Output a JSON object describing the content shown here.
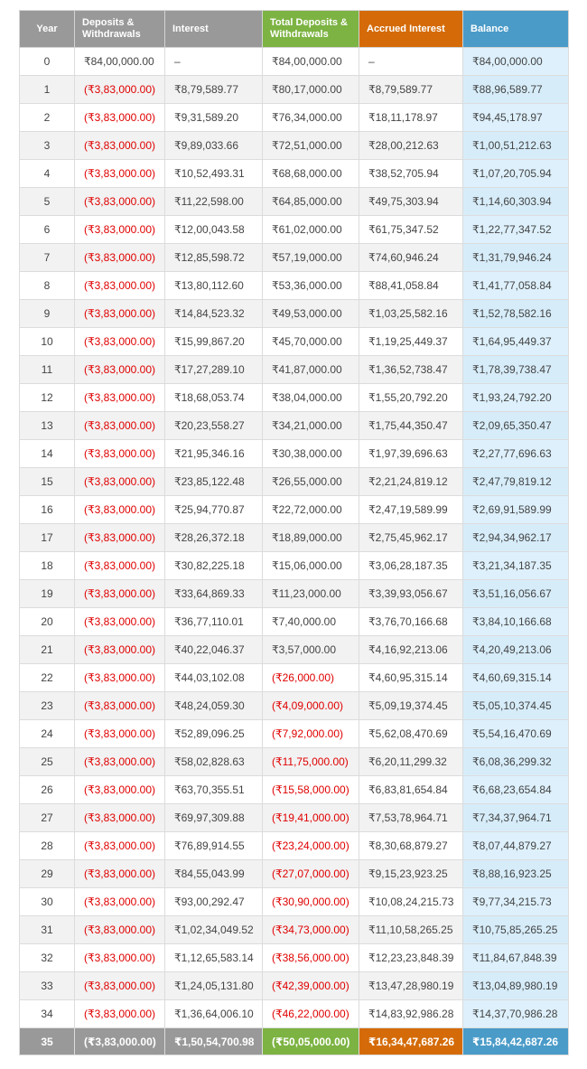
{
  "colors": {
    "header_gray": "#999999",
    "header_green": "#7cb342",
    "header_orange": "#d46b08",
    "header_blue": "#4a9bc8",
    "negative_text": "#e00000",
    "balance_cell_bg": "#ddf0fc"
  },
  "headers": [
    {
      "label": "Year",
      "color": "#999999"
    },
    {
      "label": "Deposits & Withdrawals",
      "color": "#999999"
    },
    {
      "label": "Interest",
      "color": "#999999"
    },
    {
      "label": "Total Deposits & Withdrawals",
      "color": "#7cb342"
    },
    {
      "label": "Accrued Interest",
      "color": "#d46b08"
    },
    {
      "label": "Balance",
      "color": "#4a9bc8"
    }
  ],
  "rows": [
    [
      "0",
      "₹84,00,000.00",
      "–",
      "₹84,00,000.00",
      "–",
      "₹84,00,000.00"
    ],
    [
      "1",
      "(₹3,83,000.00)",
      "₹8,79,589.77",
      "₹80,17,000.00",
      "₹8,79,589.77",
      "₹88,96,589.77"
    ],
    [
      "2",
      "(₹3,83,000.00)",
      "₹9,31,589.20",
      "₹76,34,000.00",
      "₹18,11,178.97",
      "₹94,45,178.97"
    ],
    [
      "3",
      "(₹3,83,000.00)",
      "₹9,89,033.66",
      "₹72,51,000.00",
      "₹28,00,212.63",
      "₹1,00,51,212.63"
    ],
    [
      "4",
      "(₹3,83,000.00)",
      "₹10,52,493.31",
      "₹68,68,000.00",
      "₹38,52,705.94",
      "₹1,07,20,705.94"
    ],
    [
      "5",
      "(₹3,83,000.00)",
      "₹11,22,598.00",
      "₹64,85,000.00",
      "₹49,75,303.94",
      "₹1,14,60,303.94"
    ],
    [
      "6",
      "(₹3,83,000.00)",
      "₹12,00,043.58",
      "₹61,02,000.00",
      "₹61,75,347.52",
      "₹1,22,77,347.52"
    ],
    [
      "7",
      "(₹3,83,000.00)",
      "₹12,85,598.72",
      "₹57,19,000.00",
      "₹74,60,946.24",
      "₹1,31,79,946.24"
    ],
    [
      "8",
      "(₹3,83,000.00)",
      "₹13,80,112.60",
      "₹53,36,000.00",
      "₹88,41,058.84",
      "₹1,41,77,058.84"
    ],
    [
      "9",
      "(₹3,83,000.00)",
      "₹14,84,523.32",
      "₹49,53,000.00",
      "₹1,03,25,582.16",
      "₹1,52,78,582.16"
    ],
    [
      "10",
      "(₹3,83,000.00)",
      "₹15,99,867.20",
      "₹45,70,000.00",
      "₹1,19,25,449.37",
      "₹1,64,95,449.37"
    ],
    [
      "11",
      "(₹3,83,000.00)",
      "₹17,27,289.10",
      "₹41,87,000.00",
      "₹1,36,52,738.47",
      "₹1,78,39,738.47"
    ],
    [
      "12",
      "(₹3,83,000.00)",
      "₹18,68,053.74",
      "₹38,04,000.00",
      "₹1,55,20,792.20",
      "₹1,93,24,792.20"
    ],
    [
      "13",
      "(₹3,83,000.00)",
      "₹20,23,558.27",
      "₹34,21,000.00",
      "₹1,75,44,350.47",
      "₹2,09,65,350.47"
    ],
    [
      "14",
      "(₹3,83,000.00)",
      "₹21,95,346.16",
      "₹30,38,000.00",
      "₹1,97,39,696.63",
      "₹2,27,77,696.63"
    ],
    [
      "15",
      "(₹3,83,000.00)",
      "₹23,85,122.48",
      "₹26,55,000.00",
      "₹2,21,24,819.12",
      "₹2,47,79,819.12"
    ],
    [
      "16",
      "(₹3,83,000.00)",
      "₹25,94,770.87",
      "₹22,72,000.00",
      "₹2,47,19,589.99",
      "₹2,69,91,589.99"
    ],
    [
      "17",
      "(₹3,83,000.00)",
      "₹28,26,372.18",
      "₹18,89,000.00",
      "₹2,75,45,962.17",
      "₹2,94,34,962.17"
    ],
    [
      "18",
      "(₹3,83,000.00)",
      "₹30,82,225.18",
      "₹15,06,000.00",
      "₹3,06,28,187.35",
      "₹3,21,34,187.35"
    ],
    [
      "19",
      "(₹3,83,000.00)",
      "₹33,64,869.33",
      "₹11,23,000.00",
      "₹3,39,93,056.67",
      "₹3,51,16,056.67"
    ],
    [
      "20",
      "(₹3,83,000.00)",
      "₹36,77,110.01",
      "₹7,40,000.00",
      "₹3,76,70,166.68",
      "₹3,84,10,166.68"
    ],
    [
      "21",
      "(₹3,83,000.00)",
      "₹40,22,046.37",
      "₹3,57,000.00",
      "₹4,16,92,213.06",
      "₹4,20,49,213.06"
    ],
    [
      "22",
      "(₹3,83,000.00)",
      "₹44,03,102.08",
      "(₹26,000.00)",
      "₹4,60,95,315.14",
      "₹4,60,69,315.14"
    ],
    [
      "23",
      "(₹3,83,000.00)",
      "₹48,24,059.30",
      "(₹4,09,000.00)",
      "₹5,09,19,374.45",
      "₹5,05,10,374.45"
    ],
    [
      "24",
      "(₹3,83,000.00)",
      "₹52,89,096.25",
      "(₹7,92,000.00)",
      "₹5,62,08,470.69",
      "₹5,54,16,470.69"
    ],
    [
      "25",
      "(₹3,83,000.00)",
      "₹58,02,828.63",
      "(₹11,75,000.00)",
      "₹6,20,11,299.32",
      "₹6,08,36,299.32"
    ],
    [
      "26",
      "(₹3,83,000.00)",
      "₹63,70,355.51",
      "(₹15,58,000.00)",
      "₹6,83,81,654.84",
      "₹6,68,23,654.84"
    ],
    [
      "27",
      "(₹3,83,000.00)",
      "₹69,97,309.88",
      "(₹19,41,000.00)",
      "₹7,53,78,964.71",
      "₹7,34,37,964.71"
    ],
    [
      "28",
      "(₹3,83,000.00)",
      "₹76,89,914.55",
      "(₹23,24,000.00)",
      "₹8,30,68,879.27",
      "₹8,07,44,879.27"
    ],
    [
      "29",
      "(₹3,83,000.00)",
      "₹84,55,043.99",
      "(₹27,07,000.00)",
      "₹9,15,23,923.25",
      "₹8,88,16,923.25"
    ],
    [
      "30",
      "(₹3,83,000.00)",
      "₹93,00,292.47",
      "(₹30,90,000.00)",
      "₹10,08,24,215.73",
      "₹9,77,34,215.73"
    ],
    [
      "31",
      "(₹3,83,000.00)",
      "₹1,02,34,049.52",
      "(₹34,73,000.00)",
      "₹11,10,58,265.25",
      "₹10,75,85,265.25"
    ],
    [
      "32",
      "(₹3,83,000.00)",
      "₹1,12,65,583.14",
      "(₹38,56,000.00)",
      "₹12,23,23,848.39",
      "₹11,84,67,848.39"
    ],
    [
      "33",
      "(₹3,83,000.00)",
      "₹1,24,05,131.80",
      "(₹42,39,000.00)",
      "₹13,47,28,980.19",
      "₹13,04,89,980.19"
    ],
    [
      "34",
      "(₹3,83,000.00)",
      "₹1,36,64,006.10",
      "(₹46,22,000.00)",
      "₹14,83,92,986.28",
      "₹14,37,70,986.28"
    ]
  ],
  "total_row": {
    "cells": [
      "35",
      "(₹3,83,000.00)",
      "₹1,50,54,700.98",
      "(₹50,05,000.00)",
      "₹16,34,47,687.26",
      "₹15,84,42,687.26"
    ],
    "colors": [
      "#999999",
      "#999999",
      "#999999",
      "#7cb342",
      "#d46b08",
      "#4a9bc8"
    ]
  }
}
